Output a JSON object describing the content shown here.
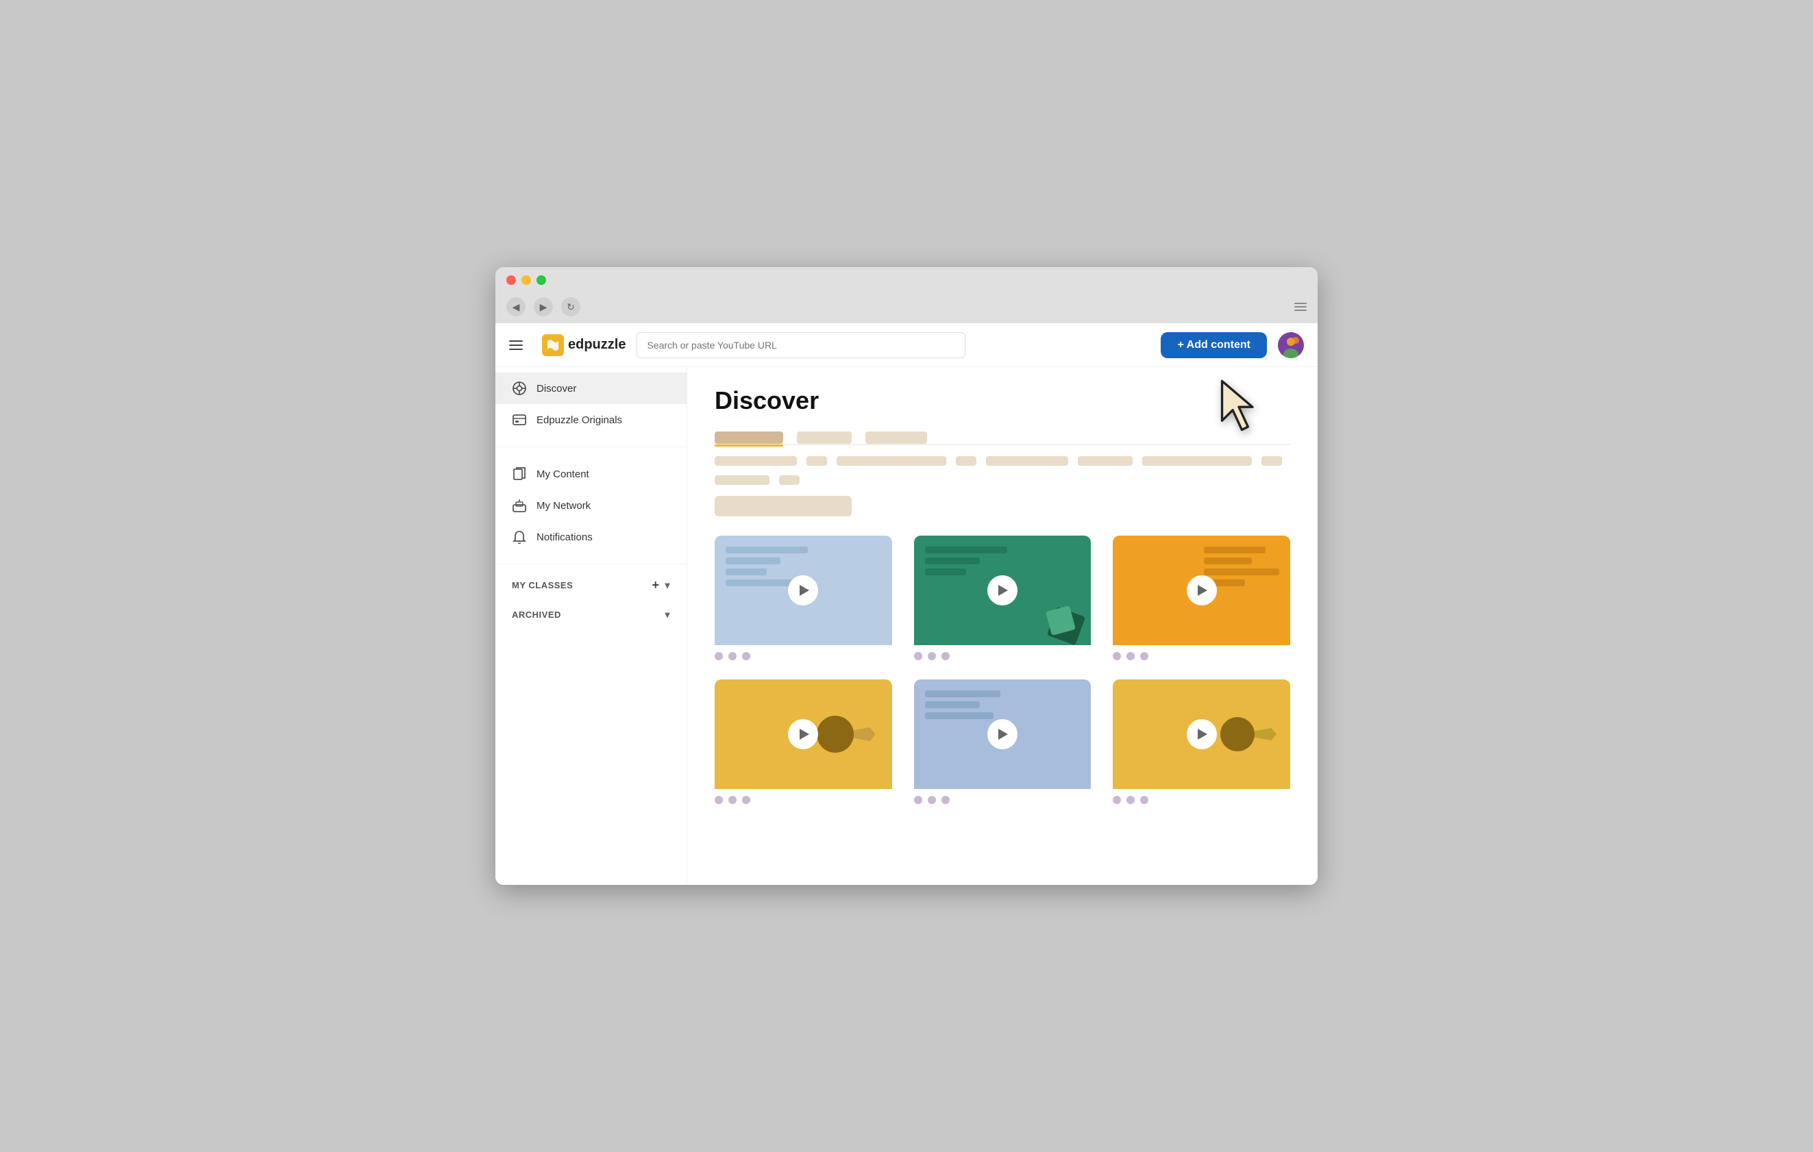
{
  "browser": {
    "back_label": "◀",
    "forward_label": "▶",
    "refresh_label": "↻"
  },
  "topbar": {
    "logo_text": "edpuzzle",
    "search_placeholder": "Search or paste YouTube URL",
    "add_content_label": "+ Add content"
  },
  "sidebar": {
    "items": [
      {
        "id": "discover",
        "label": "Discover",
        "active": true
      },
      {
        "id": "edpuzzle-originals",
        "label": "Edpuzzle Originals",
        "active": false
      },
      {
        "id": "my-content",
        "label": "My Content",
        "active": false
      },
      {
        "id": "my-network",
        "label": "My Network",
        "active": false
      },
      {
        "id": "notifications",
        "label": "Notifications",
        "active": false
      }
    ],
    "my_classes_label": "MY CLASSES",
    "archived_label": "ARCHIVED"
  },
  "main": {
    "page_title": "Discover"
  }
}
